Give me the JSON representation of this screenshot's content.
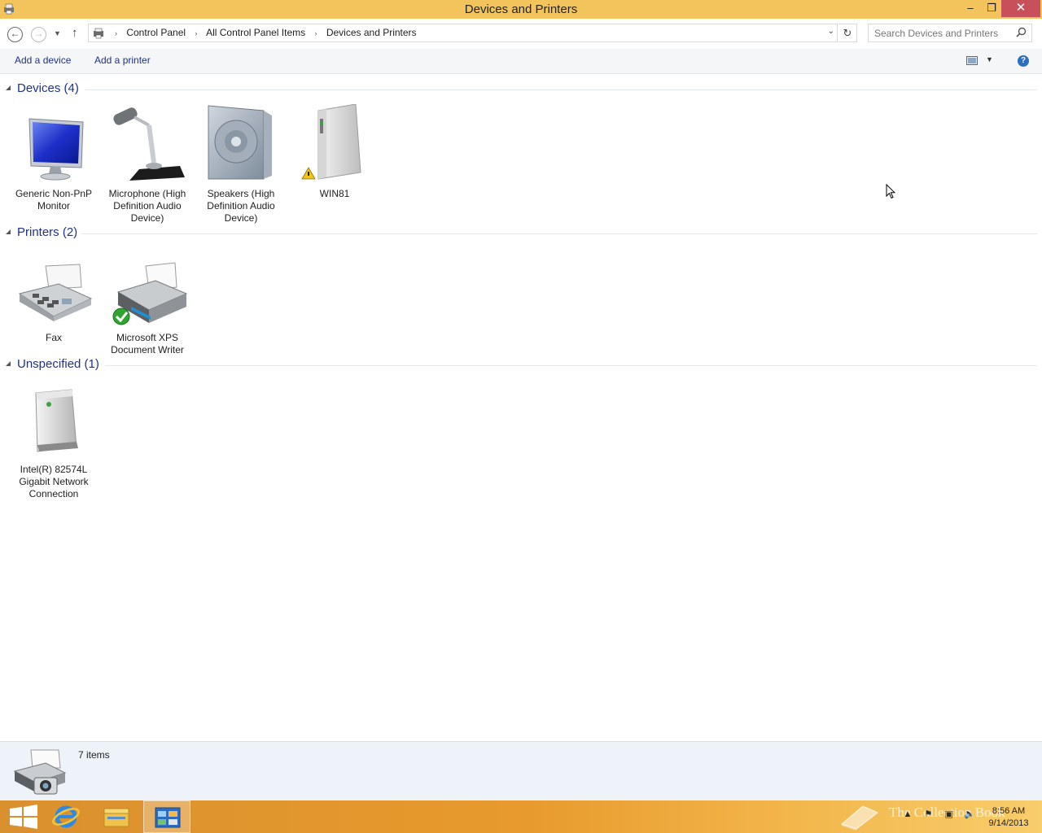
{
  "window": {
    "title": "Devices and Printers",
    "min_glyph": "–",
    "max_glyph": "❐",
    "close_glyph": "✕"
  },
  "nav": {
    "back_glyph": "←",
    "forward_glyph": "→",
    "recent_glyph": "▼",
    "up_glyph": "↑",
    "breadcrumbs": [
      "Control Panel",
      "All Control Panel Items",
      "Devices and Printers"
    ],
    "crumb_sep": "›",
    "address_dropdown_glyph": "⌄",
    "refresh_glyph": "↻",
    "search_placeholder": "Search Devices and Printers"
  },
  "commands": {
    "add_device": "Add a device",
    "add_printer": "Add a printer",
    "view_dropdown_glyph": "▼",
    "help_glyph": "?"
  },
  "groups": {
    "devices": {
      "title": "Devices (4)",
      "items": [
        {
          "label": "Generic Non-PnP Monitor",
          "icon": "monitor-icon"
        },
        {
          "label": "Microphone (High Definition Audio Device)",
          "icon": "microphone-icon"
        },
        {
          "label": "Speakers (High Definition Audio Device)",
          "icon": "speaker-icon"
        },
        {
          "label": "WIN81",
          "icon": "computer-tower-icon",
          "status": "warning"
        }
      ]
    },
    "printers": {
      "title": "Printers (2)",
      "items": [
        {
          "label": "Fax",
          "icon": "fax-icon"
        },
        {
          "label": "Microsoft XPS Document Writer",
          "icon": "printer-icon",
          "status": "default"
        }
      ]
    },
    "unspecified": {
      "title": "Unspecified (1)",
      "items": [
        {
          "label": "Intel(R) 82574L Gigabit Network Connection",
          "icon": "network-adapter-icon"
        }
      ]
    }
  },
  "details": {
    "count": "7 items"
  },
  "taskbar": {
    "apps": [
      "start-button",
      "internet-explorer",
      "file-explorer",
      "control-panel"
    ],
    "time": "8:56 AM",
    "date": "9/14/2013",
    "watermark": "The Collection Book"
  },
  "colors": {
    "titlebar": "#f3c45c",
    "close_button": "#c7505a",
    "link_blue": "#1e3287",
    "details_pane": "#eef3fa"
  }
}
